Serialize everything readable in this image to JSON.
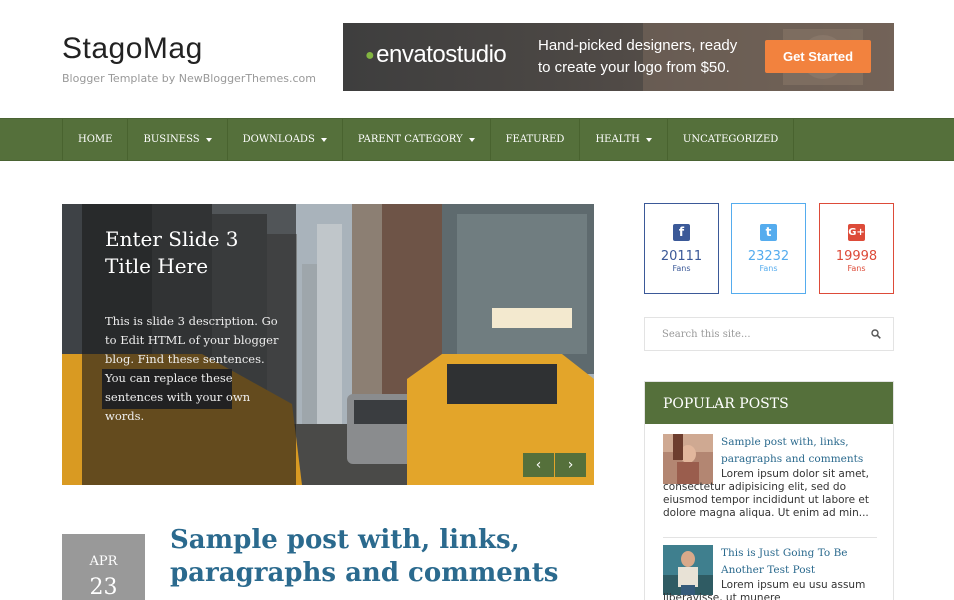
{
  "header": {
    "logo": "StagoMag",
    "tagline": "Blogger Template by NewBloggerThemes.com"
  },
  "ad": {
    "brand": "envatostudio",
    "text": "Hand-picked designers, ready to create your logo from $50.",
    "button": "Get Started"
  },
  "nav": {
    "items": [
      {
        "label": "HOME",
        "dropdown": false
      },
      {
        "label": "BUSINESS",
        "dropdown": true
      },
      {
        "label": "DOWNLOADS",
        "dropdown": true
      },
      {
        "label": "PARENT CATEGORY",
        "dropdown": true
      },
      {
        "label": "FEATURED",
        "dropdown": false
      },
      {
        "label": "HEALTH",
        "dropdown": true
      },
      {
        "label": "UNCATEGORIZED",
        "dropdown": false
      }
    ]
  },
  "slider": {
    "title": "Enter Slide 3 Title Here",
    "description": "This is slide 3 description. Go to Edit HTML of your blogger blog. Find these sentences. You can replace these sentences with your own words.",
    "prev": "‹",
    "next": "›"
  },
  "post": {
    "month": "APR",
    "day": "23",
    "title": "Sample post with, links, paragraphs and comments"
  },
  "social": {
    "facebook": {
      "icon": "facebook-icon",
      "count": "20111",
      "label": "Fans",
      "color": "#3b5998"
    },
    "twitter": {
      "icon": "twitter-icon",
      "count": "23232",
      "label": "Fans",
      "color": "#55acee"
    },
    "googleplus": {
      "icon": "google-plus-icon",
      "count": "19998",
      "label": "Fans",
      "color": "#dd4b39"
    }
  },
  "search": {
    "placeholder": "Search this site..."
  },
  "popular": {
    "heading": "POPULAR POSTS",
    "posts": [
      {
        "title": "Sample post with, links, paragraphs and comments",
        "excerpt_first": "Lorem ipsum dolor sit amet,",
        "excerpt_rest": "consectetur adipisicing elit, sed do eiusmod tempor incididunt ut labore et dolore magna aliqua. Ut enim ad min..."
      },
      {
        "title": "This is Just Going To Be Another Test Post",
        "excerpt_first": "Lorem ipsum eu usu assum",
        "excerpt_rest": "liberavisse, ut munere"
      }
    ]
  },
  "colors": {
    "nav_green": "#55703b",
    "link_blue": "#2b6a8e",
    "ad_button": "#f2823e"
  }
}
